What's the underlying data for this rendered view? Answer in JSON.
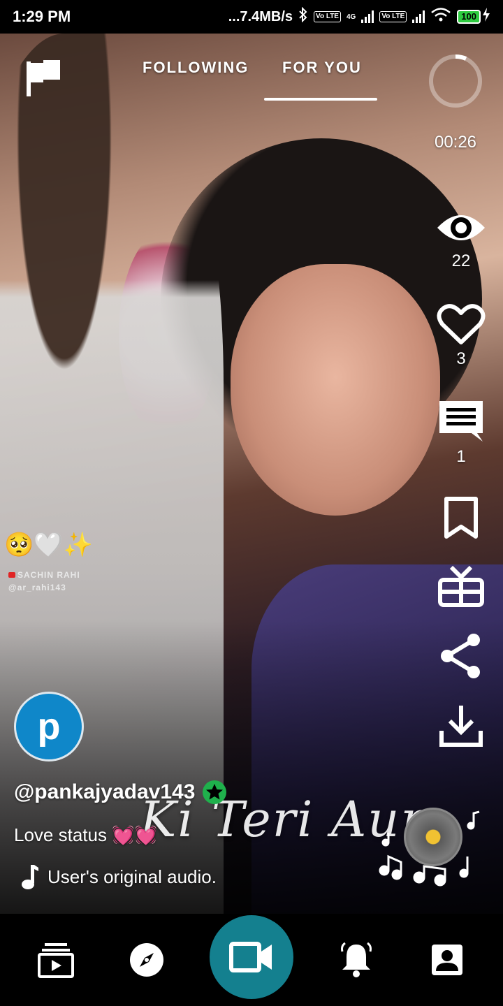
{
  "status_bar": {
    "time": "1:29 PM",
    "network_speed": "...7.4MB/s",
    "volte_label": "Vo LTE",
    "net_label": "4G",
    "battery": "100"
  },
  "top_nav": {
    "tabs": [
      {
        "label": "FOLLOWING",
        "active": false
      },
      {
        "label": "FOR YOU",
        "active": true
      }
    ],
    "timer": "00:26"
  },
  "rail": {
    "views": "22",
    "likes": "3",
    "comments": "1"
  },
  "overlay": {
    "emojis": "🥺🤍✨",
    "watermark_line1": "SACHIN RAHI",
    "watermark_line2": "@ar_rahi143",
    "lyric": "Ki Teri Aur"
  },
  "creator": {
    "avatar_letter": "p",
    "username": "@pankajyadav143",
    "caption": "Love status 💓💓",
    "audio": "User's original audio."
  },
  "colors": {
    "record_button": "#14808f",
    "avatar_bg": "#0f87c9",
    "verified": "#1fb04c"
  },
  "icons": [
    "flag-icon",
    "eye-icon",
    "heart-icon",
    "comment-icon",
    "bookmark-icon",
    "gift-icon",
    "share-icon",
    "download-icon",
    "music-note-icon",
    "feed-icon",
    "compass-icon",
    "video-camera-icon",
    "bell-icon",
    "profile-icon"
  ]
}
